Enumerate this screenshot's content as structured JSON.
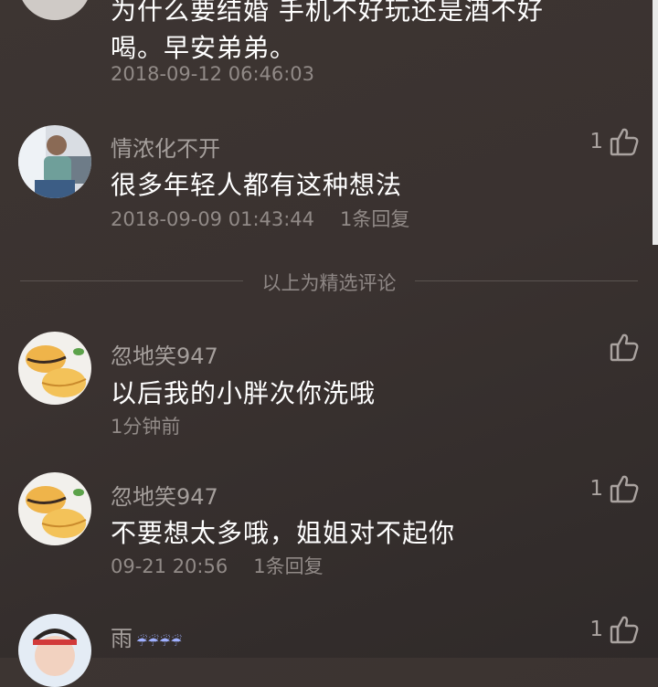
{
  "comments": [
    {
      "text_line1": "为什么要结婚 手机不好玩还是酒不好",
      "text_line2": "喝。早安弟弟。",
      "time": "2018-09-12 06:46:03"
    },
    {
      "username": "情浓化不开",
      "text": "很多年轻人都有这种想法",
      "time": "2018-09-09 01:43:44",
      "replies": "1条回复",
      "likes": "1"
    },
    {
      "username": "忽地笑947",
      "text": "以后我的小胖次你洗哦",
      "time": "1分钟前",
      "likes": ""
    },
    {
      "username": "忽地笑947",
      "text": "不要想太多哦，姐姐对不起你",
      "time": "09-21 20:56",
      "replies": "1条回复",
      "likes": "1"
    },
    {
      "username": "雨",
      "likes": "1"
    }
  ],
  "divider_label": "以上为精选评论",
  "icons": {
    "like": "thumbs-up-icon"
  }
}
